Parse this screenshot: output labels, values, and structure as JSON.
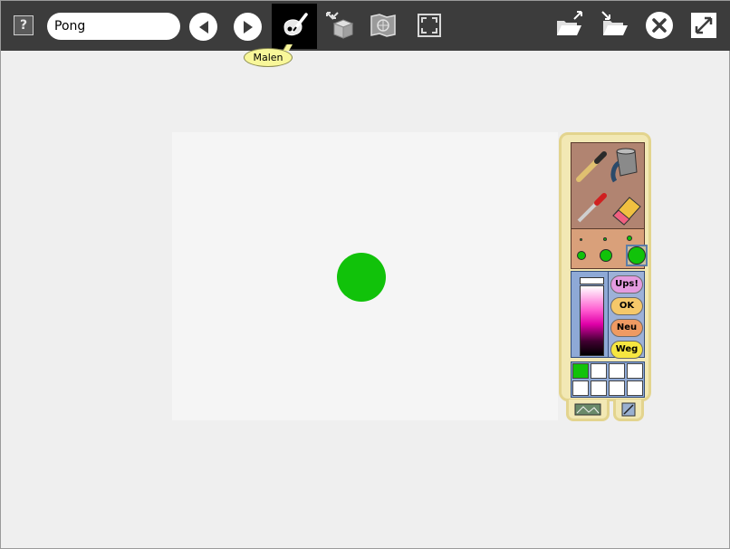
{
  "toolbar": {
    "help_label": "?",
    "project_name": "Pong",
    "tooltip": "Malen"
  },
  "icons": {
    "help": "help-icon",
    "back": "back-arrow-icon",
    "forward": "forward-arrow-icon",
    "paint": "paint-brush-icon",
    "objects": "object-box-icon",
    "world": "world-map-icon",
    "fullscreen": "fullscreen-icon",
    "open": "open-folder-icon",
    "share": "share-folder-icon",
    "stop": "stop-icon",
    "expand": "expand-icon"
  },
  "palette": {
    "tools": [
      "brush",
      "bucket",
      "eyedropper",
      "eraser"
    ],
    "actions": [
      {
        "label": "Ups!",
        "color": "#e49be0"
      },
      {
        "label": "OK",
        "color": "#f5c86a"
      },
      {
        "label": "Neu",
        "color": "#ef9a62"
      },
      {
        "label": "Weg",
        "color": "#f6e640"
      }
    ],
    "selected_color": "#11c20a",
    "swatches": [
      "#11c20a",
      "#ffffff",
      "#ffffff",
      "#ffffff",
      "#ffffff",
      "#ffffff",
      "#ffffff",
      "#ffffff"
    ]
  },
  "canvas": {
    "ball_color": "#11c20a"
  }
}
